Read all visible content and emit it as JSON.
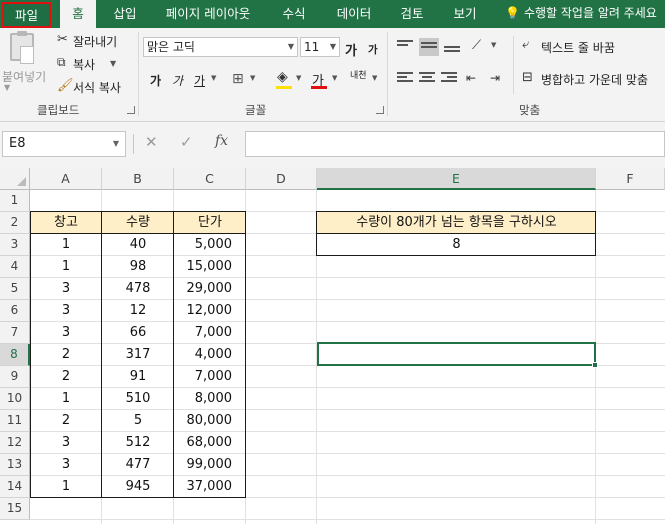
{
  "tabs": [
    {
      "label": "파일"
    },
    {
      "label": "홈"
    },
    {
      "label": "삽입"
    },
    {
      "label": "페이지 레이아웃"
    },
    {
      "label": "수식"
    },
    {
      "label": "데이터"
    },
    {
      "label": "검토"
    },
    {
      "label": "보기"
    }
  ],
  "tell_me": "수행할 작업을 알려 주세요",
  "ribbon": {
    "clipboard": {
      "paste": "붙여넣기",
      "cut": "잘라내기",
      "copy": "복사",
      "format_painter": "서식 복사",
      "group": "클립보드"
    },
    "font": {
      "name": "맑은 고딕",
      "size": "11",
      "grow": "가",
      "shrink": "가",
      "bold": "가",
      "italic": "가",
      "underline": "가",
      "color_a": "가",
      "phonetic": "내천",
      "group": "글꼴"
    },
    "alignment": {
      "wrap": "텍스트 줄 바꿈",
      "merge": "병합하고 가운데 맞춤",
      "group": "맞춤"
    }
  },
  "formula_bar": {
    "name_box": "E8",
    "formula": ""
  },
  "sheet": {
    "columns": [
      "A",
      "B",
      "C",
      "D",
      "E",
      "F"
    ],
    "rows": [
      "1",
      "2",
      "3",
      "4",
      "5",
      "6",
      "7",
      "8",
      "9",
      "10",
      "11",
      "12",
      "13",
      "14",
      "15"
    ],
    "selected_column": "E",
    "selected_row": "8",
    "table_headers": [
      "창고",
      "수량",
      "단가"
    ],
    "table_rows": [
      [
        "1",
        "40",
        "5,000"
      ],
      [
        "1",
        "98",
        "15,000"
      ],
      [
        "3",
        "478",
        "29,000"
      ],
      [
        "3",
        "12",
        "12,000"
      ],
      [
        "3",
        "66",
        "7,000"
      ],
      [
        "2",
        "317",
        "4,000"
      ],
      [
        "2",
        "91",
        "7,000"
      ],
      [
        "1",
        "510",
        "8,000"
      ],
      [
        "2",
        "5",
        "80,000"
      ],
      [
        "3",
        "512",
        "68,000"
      ],
      [
        "3",
        "477",
        "99,000"
      ],
      [
        "1",
        "945",
        "37,000"
      ]
    ],
    "question": "수량이 80개가 넘는 항목을 구하시오",
    "answer": "8"
  },
  "colors": {
    "excel_green": "#217346",
    "header_fill": "#ffefc9",
    "highlight_red": "#e01010"
  }
}
